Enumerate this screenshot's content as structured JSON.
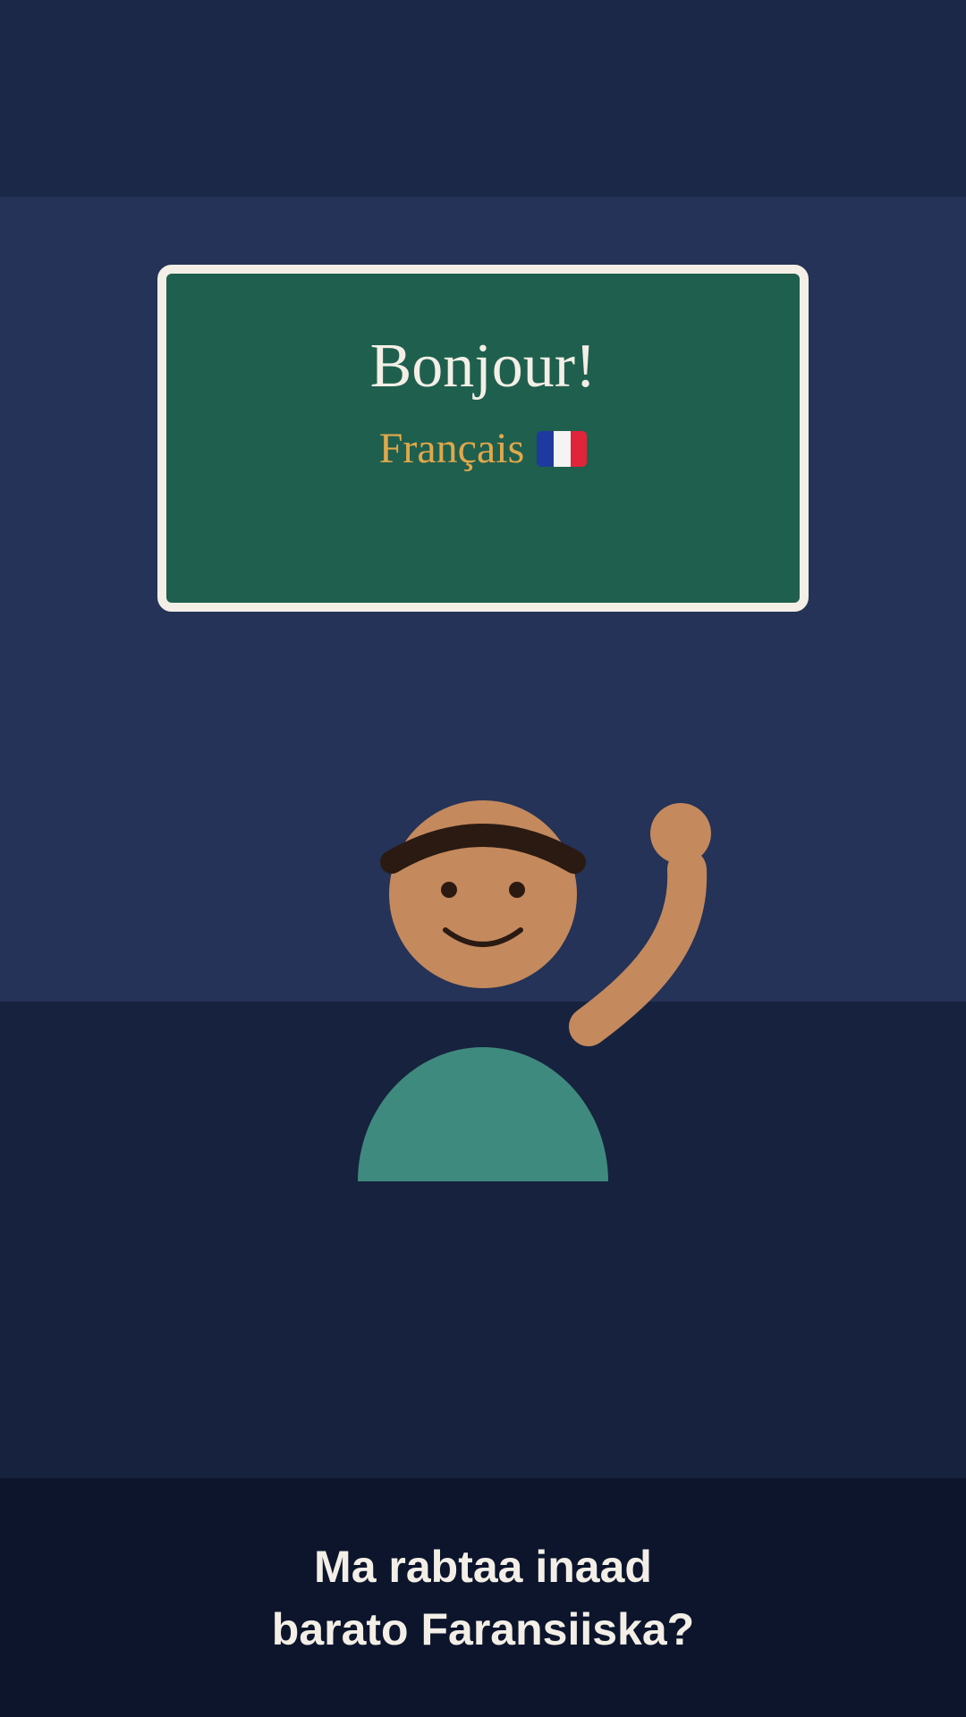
{
  "board": {
    "greeting": "Bonjour!",
    "language": "Français",
    "flag_icon": "france-flag-icon"
  },
  "caption": {
    "line1": "Ma rabtaa inaad",
    "line2": "barato Faransiiska?"
  },
  "colors": {
    "background_top": "#1c2848",
    "wall": "#243357",
    "floor": "#17223e",
    "caption_bar": "#0d152d",
    "board": "#1f5f4e",
    "board_border": "#f3efe6",
    "language_text": "#e0a84a",
    "skin": "#c4895d",
    "hair": "#2a1a12",
    "shirt": "#3f8a7e"
  }
}
